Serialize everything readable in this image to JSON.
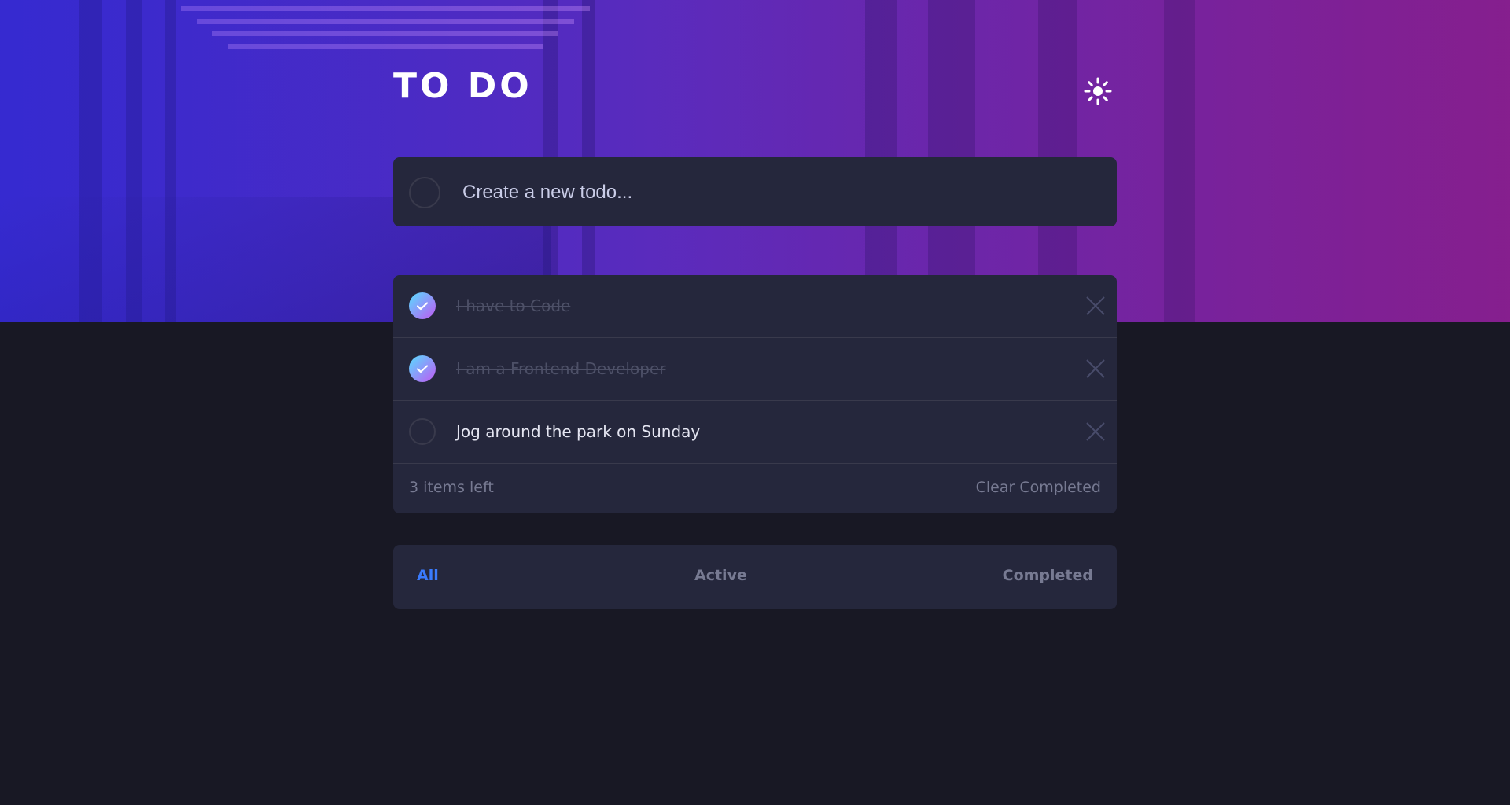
{
  "app": {
    "title": "TO DO",
    "theme_icon": "sun-icon"
  },
  "new_todo": {
    "placeholder": "Create a new todo..."
  },
  "todos": [
    {
      "text": "I have to Code",
      "completed": true
    },
    {
      "text": "I am a Frontend Developer",
      "completed": true
    },
    {
      "text": "Jog around the park on Sunday",
      "completed": false
    }
  ],
  "footer": {
    "items_left": "3 items left",
    "clear_completed": "Clear Completed"
  },
  "filters": {
    "all": "All",
    "active": "Active",
    "completed": "Completed",
    "selected": "All"
  },
  "colors": {
    "accent": "#3a7bfd",
    "background": "#181824",
    "card": "#25273c",
    "check_gradient_start": "#57ddff",
    "check_gradient_end": "#c058f3"
  }
}
